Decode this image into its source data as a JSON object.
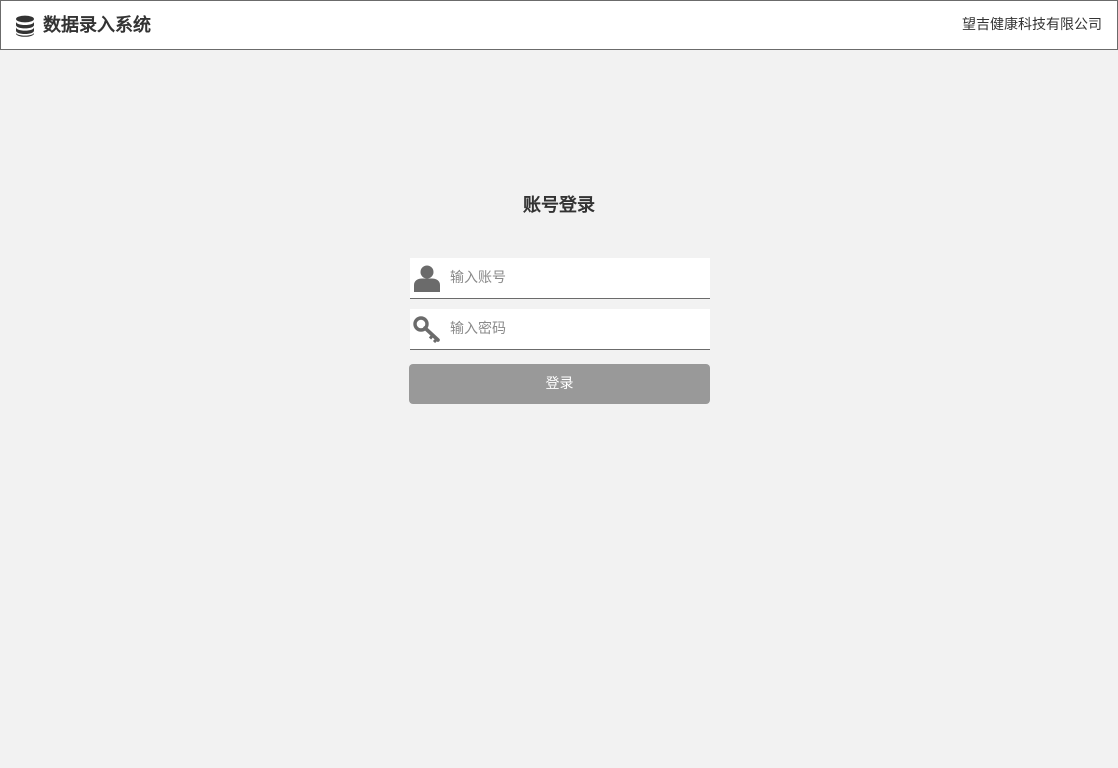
{
  "header": {
    "title": "数据录入系统",
    "company": "望吉健康科技有限公司",
    "logo_icon": "database-icon"
  },
  "login": {
    "title": "账号登录",
    "account": {
      "icon": "user-icon",
      "value": "",
      "placeholder": "输入账号"
    },
    "password": {
      "icon": "key-icon",
      "value": "",
      "placeholder": "输入密码"
    },
    "submit_label": "登录"
  },
  "colors": {
    "background": "#f2f2f2",
    "header_background": "#ffffff",
    "header_border": "#6b6b6b",
    "text": "#333333",
    "placeholder": "#8a8a8a",
    "icon": "#6b6b6b",
    "button_background": "#999999",
    "button_text": "#ffffff"
  }
}
